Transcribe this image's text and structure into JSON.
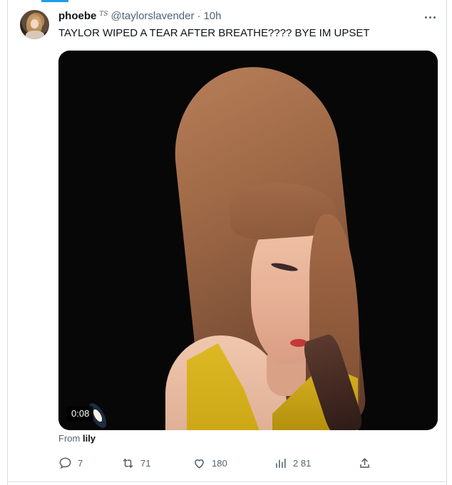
{
  "tweet": {
    "display_name": "phoebe",
    "badge": "TS",
    "handle": "@taylorslavender",
    "separator": "·",
    "time": "10h",
    "text": "TAYLOR WIPED A TEAR AFTER BREATHE???? BYE IM UPSET",
    "video_duration": "0:08",
    "from_prefix": "From",
    "from_name": "lily"
  },
  "actions": {
    "reply_count": "7",
    "retweet_count": "71",
    "like_count": "180",
    "views_count": "2 81"
  },
  "icons": {
    "more": "more-horizontal-icon",
    "reply": "reply-icon",
    "retweet": "retweet-icon",
    "like": "heart-icon",
    "views": "views-bar-icon",
    "share": "share-icon"
  },
  "colors": {
    "accent": "#1d9bf0",
    "text_primary": "#0f1419",
    "text_secondary": "#536471"
  }
}
